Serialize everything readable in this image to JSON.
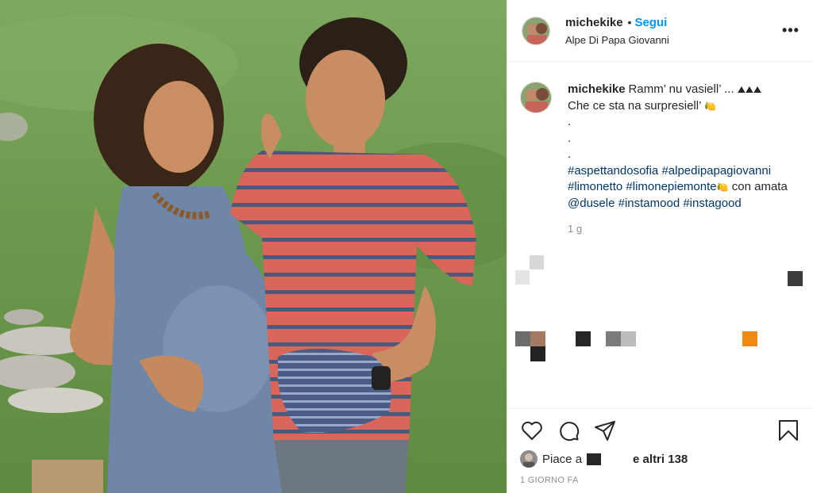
{
  "post": {
    "username": "michekike",
    "separator": "•",
    "follow_label": "Segui",
    "location": "Alpe Di Papa Giovanni",
    "more_label": "•••"
  },
  "caption": {
    "username": "michekike",
    "line1": "Ramm’ nu vasiell’ ... ",
    "line1_emoji": "⛰⛰⛰",
    "line2": "Che ce sta na surpresiell’ ",
    "line2_emoji": "🍋",
    "dot": ".",
    "hashtags": [
      "#aspettandosofia",
      "#alpedipapagiovanni",
      "#limonetto",
      "#limonepiemonte"
    ],
    "hashtag_emoji": "🍋",
    "connector": " con amata ",
    "mention": "@dusele",
    "tail_tags": [
      "#instamood",
      "#instagood"
    ],
    "age": "1 g"
  },
  "likes": {
    "prefix": "Piace a",
    "suffix": "e altri 138"
  },
  "timestamp": "1 GIORNO FA",
  "colors": {
    "follow": "#0095f6",
    "hashtag": "#00376b",
    "muted": "#8e8e8e",
    "text": "#262626"
  },
  "icons": [
    "heart-icon",
    "comment-icon",
    "share-icon",
    "bookmark-icon",
    "more-icon"
  ]
}
